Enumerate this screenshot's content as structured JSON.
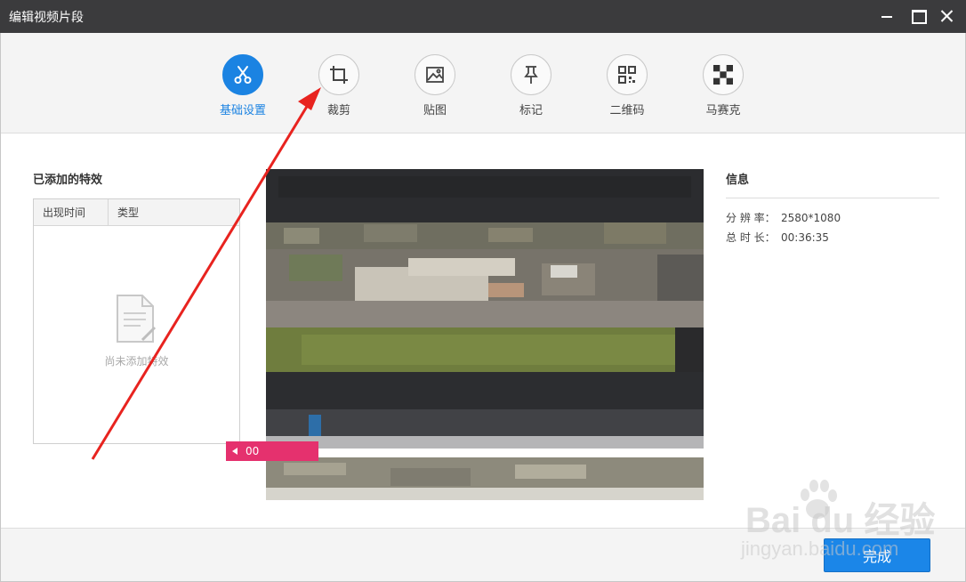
{
  "window": {
    "title": "编辑视频片段"
  },
  "toolbar": {
    "items": [
      {
        "label": "基础设置",
        "icon": "scissors-icon",
        "active": true
      },
      {
        "label": "裁剪",
        "icon": "crop-icon",
        "active": false
      },
      {
        "label": "贴图",
        "icon": "image-icon",
        "active": false
      },
      {
        "label": "标记",
        "icon": "pin-icon",
        "active": false
      },
      {
        "label": "二维码",
        "icon": "qrcode-icon",
        "active": false
      },
      {
        "label": "马赛克",
        "icon": "mosaic-icon",
        "active": false
      }
    ]
  },
  "effects": {
    "title": "已添加的特效",
    "columns": [
      "出现时间",
      "类型"
    ],
    "empty_text": "尚未添加特效"
  },
  "timeline": {
    "marker_label": "00"
  },
  "info": {
    "title": "信息",
    "resolution_label": "分 辨 率：",
    "resolution_value": "2580*1080",
    "duration_label": "总 时 长：",
    "duration_value": "00:36:35"
  },
  "footer": {
    "done_label": "完成"
  },
  "watermark": {
    "text": "Bai du 经验",
    "url": "jingyan.baidu.com"
  },
  "colors": {
    "accent": "#1b83e2",
    "titlebar": "#3b3b3d",
    "marker": "#e5316e",
    "annotation_arrow": "#e8231f"
  }
}
